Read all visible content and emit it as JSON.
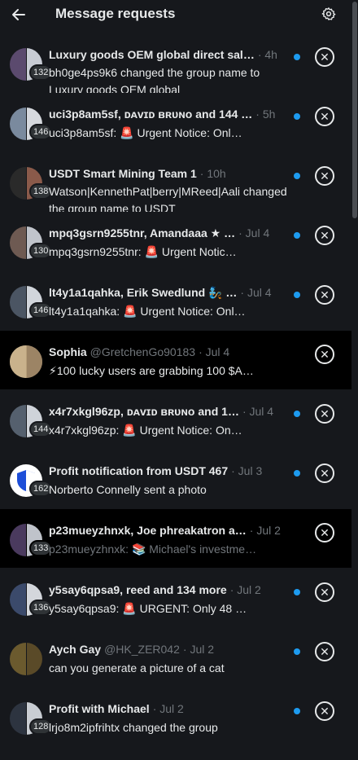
{
  "header": {
    "title": "Message requests"
  },
  "requests": [
    {
      "name": "Luxury goods OEM global direct sal…",
      "handle": "",
      "time": "· 4h",
      "badge": "132",
      "preview": "bh0ge4ps9k6 changed the group name to Luxury goods OEM global"
    },
    {
      "name": "uci3p8am5sf, ᴅᴀᴠɪᴅ ʙʀᴜɴᴏ and 144 …",
      "handle": "",
      "time": "· 5h",
      "badge": "146",
      "preview": "uci3p8am5sf: 🚨 Urgent Notice: Onl…"
    },
    {
      "name": "USDT Smart Mining Team 1",
      "handle": "",
      "time": "· 10h",
      "badge": "138",
      "preview": "Watson|KennethPat|berry|MReed|Aali changed the group name to USDT"
    },
    {
      "name": "mpq3gsrn9255tnr, Amandaaa ★ …",
      "handle": "",
      "time": "· Jul 4",
      "badge": "130",
      "preview": "mpq3gsrn9255tnr: 🚨 Urgent Notic…"
    },
    {
      "name": "lt4y1a1qahka, Erik Swedlund 🧞 …",
      "handle": "",
      "time": "· Jul 4",
      "badge": "146",
      "preview": "lt4y1a1qahka: 🚨 Urgent Notice: Onl…"
    },
    {
      "name": "Sophia",
      "handle": "@GretchenGo90183",
      "time": "· Jul 4",
      "badge": "",
      "preview": "⚡100 lucky users are grabbing 100 $A…"
    },
    {
      "name": "x4r7xkgl96zp, ᴅᴀᴠɪᴅ ʙʀᴜɴᴏ and 1…",
      "handle": "",
      "time": "· Jul 4",
      "badge": "144",
      "preview": "x4r7xkgl96zp: 🚨 Urgent Notice: On…"
    },
    {
      "name": "Profit notification from USDT 467",
      "handle": "",
      "time": "· Jul 3",
      "badge": "162",
      "preview": "Norberto Connelly sent a photo"
    },
    {
      "name": "p23mueyzhnxk, Joe phreakatron a…",
      "handle": "",
      "time": "· Jul 2",
      "badge": "133",
      "preview": "p23mueyzhnxk: 📚 Michael's investme…"
    },
    {
      "name": "y5say6qpsa9, reed and 134 more",
      "handle": "",
      "time": "· Jul 2",
      "badge": "136",
      "preview": "y5say6qpsa9: 🚨 URGENT: Only 48 …"
    },
    {
      "name": "Aych Gay",
      "handle": "@HK_ZER042",
      "time": "· Jul 2",
      "badge": "",
      "preview": "can you generate a picture of a cat"
    },
    {
      "name": "Profit with Michael",
      "handle": "",
      "time": "· Jul 2",
      "badge": "128",
      "preview": "lrjo8m2ipfrihtx changed the group"
    }
  ],
  "colors": {
    "accent": "#1d9bf0",
    "background": "#16181c",
    "muted": "#71767b",
    "text": "#e7e9ea"
  }
}
